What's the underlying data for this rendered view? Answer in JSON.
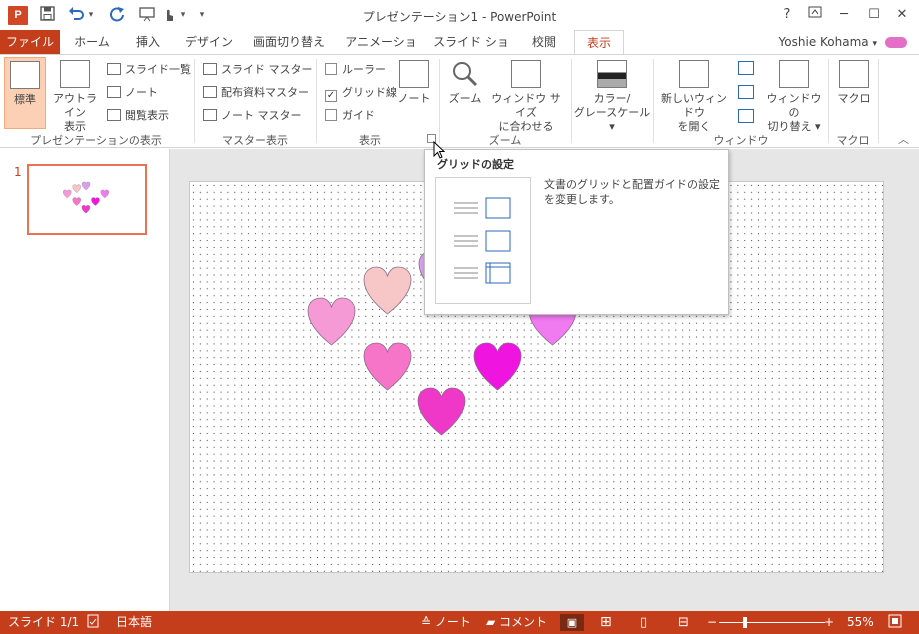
{
  "window": {
    "title": "プレゼンテーション1 - PowerPoint",
    "logo_letter": "P",
    "help": "?",
    "restore": "⊡",
    "minimize": "─",
    "maximize": "☐",
    "close": "✕"
  },
  "quick_access": {
    "save_icon": "💾",
    "undo_icon": "↶",
    "redo_icon": "↻",
    "menu_icon": "▾"
  },
  "tabs": [
    "ファイル",
    "ホーム",
    "挿入",
    "デザイン",
    "画面切り替え",
    "アニメーション",
    "スライド ショー",
    "校閲",
    "表示"
  ],
  "active_tab": "表示",
  "user": {
    "name": "Yoshie Kohama",
    "caret": "▾"
  },
  "ribbon": {
    "presentation_views": {
      "label": "プレゼンテーションの表示",
      "normal": "標準",
      "outline": [
        "アウトライン",
        "表示"
      ],
      "slide_sorter": "スライド一覧",
      "notes": "ノート",
      "reading": "閲覧表示"
    },
    "master_views": {
      "label": "マスター表示",
      "slide_master": "スライド マスター",
      "handout_master": "配布資料マスター",
      "notes_master": "ノート マスター"
    },
    "show": {
      "label": "表示",
      "ruler": "ルーラー",
      "gridlines": "グリッド線",
      "guides": "ガイド",
      "notes": "ノート",
      "ruler_checked": false,
      "gridlines_checked": true,
      "guides_checked": false,
      "check_mark": "✓"
    },
    "zoom": {
      "label": "ズーム",
      "zoom": "ズーム",
      "fit": [
        "ウィンドウ サイズ",
        "に合わせる"
      ]
    },
    "color": {
      "label": [
        "カラー/",
        "グレースケール ▾"
      ]
    },
    "window": {
      "label": "ウィンドウ",
      "new_window": [
        "新しいウィンドウ",
        "を開く"
      ],
      "switch": [
        "ウィンドウの",
        "切り替え ▾"
      ]
    },
    "macros": {
      "label": "マクロ",
      "macros": "マクロ"
    },
    "collapse": "︿",
    "launcher": "⧉"
  },
  "tooltip": {
    "title": "グリッドの設定",
    "description": "文書のグリッドと配置ガイドの設定を変更します。"
  },
  "thumbnail": {
    "number": "1"
  },
  "hearts": [
    {
      "color": "#f7c6c6"
    },
    {
      "color": "#f59ad4"
    },
    {
      "color": "#f675c8"
    },
    {
      "color": "#f014e0"
    },
    {
      "color": "#f038c8"
    },
    {
      "color": "#f07af0"
    },
    {
      "color": "#d8a0e8"
    }
  ],
  "status": {
    "slide": "スライド 1/1",
    "lang": "日本語",
    "notes": "ノート",
    "comments": "コメント",
    "zoom": "55%",
    "minus": "−",
    "plus": "+"
  }
}
